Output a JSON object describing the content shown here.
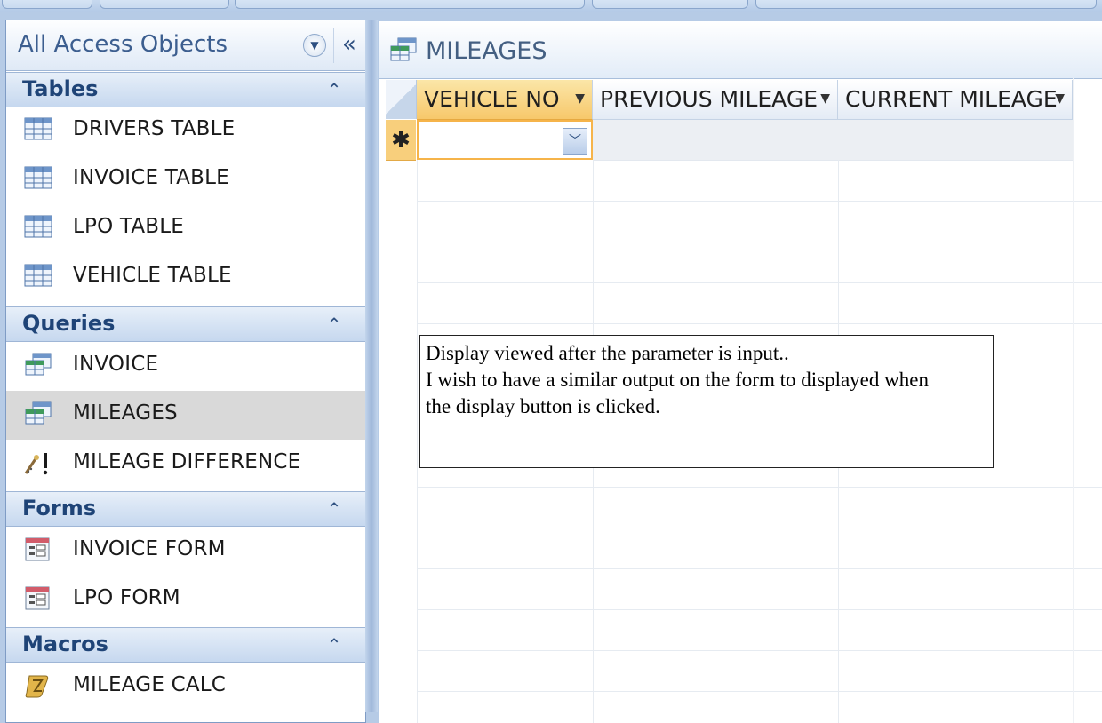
{
  "nav": {
    "title": "All Access Objects",
    "groups": [
      {
        "label": "Tables",
        "items": [
          {
            "label": "DRIVERS TABLE",
            "icon": "table-icon"
          },
          {
            "label": "INVOICE TABLE",
            "icon": "table-icon"
          },
          {
            "label": "LPO TABLE",
            "icon": "table-icon"
          },
          {
            "label": "VEHICLE TABLE",
            "icon": "table-icon"
          }
        ]
      },
      {
        "label": "Queries",
        "items": [
          {
            "label": "INVOICE",
            "icon": "query-icon"
          },
          {
            "label": "MILEAGES",
            "icon": "query-icon",
            "selected": true
          },
          {
            "label": "MILEAGE DIFFERENCE",
            "icon": "update-query-icon"
          }
        ]
      },
      {
        "label": "Forms",
        "items": [
          {
            "label": "INVOICE FORM",
            "icon": "form-icon"
          },
          {
            "label": "LPO FORM",
            "icon": "form-icon"
          }
        ]
      },
      {
        "label": "Macros",
        "items": [
          {
            "label": "MILEAGE CALC",
            "icon": "macro-icon"
          }
        ]
      }
    ]
  },
  "document": {
    "tab_title": "MILEAGES",
    "columns": [
      "VEHICLE NO",
      "PREVIOUS MILEAGE",
      "CURRENT MILEAGE"
    ],
    "new_row_marker": "✱"
  },
  "annotation": {
    "lines": [
      "Display viewed after the parameter is input..",
      "I wish to have a similar output on the form to displayed when",
      "the display button is clicked."
    ]
  },
  "colors": {
    "accent": "#f7c86b",
    "nav_header_text": "#1f4477",
    "selection": "#d9d9d9"
  }
}
